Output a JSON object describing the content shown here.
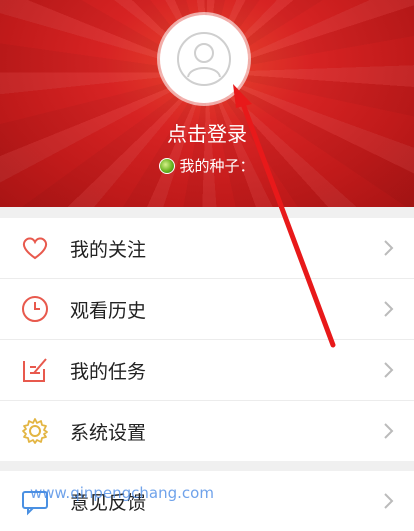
{
  "profile": {
    "login_label": "点击登录",
    "seeds_label": "我的种子："
  },
  "menu": [
    {
      "label": "我的关注",
      "icon": "heart-icon"
    },
    {
      "label": "观看历史",
      "icon": "clock-icon"
    },
    {
      "label": "我的任务",
      "icon": "edit-icon"
    },
    {
      "label": "系统设置",
      "icon": "gear-icon"
    }
  ],
  "menu2": [
    {
      "label": "意见反馈",
      "icon": "chat-icon"
    }
  ],
  "watermark": "www.qinpengchang.com",
  "colors": {
    "header_red": "#d72323",
    "icon_red": "#e8594d",
    "icon_gold": "#e3b542",
    "arrow_red": "#e8191a"
  }
}
